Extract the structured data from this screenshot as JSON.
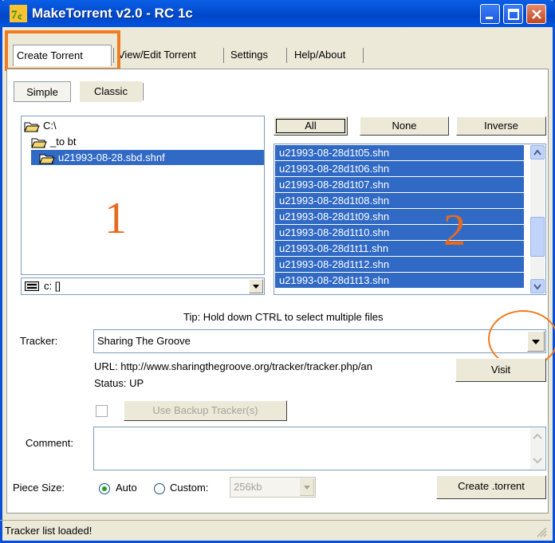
{
  "window": {
    "title": "MakeTorrent v2.0 - RC 1c"
  },
  "menu_tabs": [
    "Create Torrent",
    "View/Edit Torrent",
    "Settings",
    "Help/About"
  ],
  "mode_tabs": [
    "Simple",
    "Classic"
  ],
  "tree": {
    "items": [
      "C:\\",
      "_to bt",
      "u21993-08-28.sbd.shnf"
    ],
    "selected": "u21993-08-28.sbd.shnf"
  },
  "drive": {
    "value": "c: []"
  },
  "annotations": {
    "left_number": "1",
    "right_number": "2"
  },
  "select_buttons": {
    "all": "All",
    "none": "None",
    "inverse": "Inverse"
  },
  "files": [
    "u21993-08-28d1t05.shn",
    "u21993-08-28d1t06.shn",
    "u21993-08-28d1t07.shn",
    "u21993-08-28d1t08.shn",
    "u21993-08-28d1t09.shn",
    "u21993-08-28d1t10.shn",
    "u21993-08-28d1t11.shn",
    "u21993-08-28d1t12.shn",
    "u21993-08-28d1t13.shn"
  ],
  "tip": "Tip: Hold down CTRL to select multiple files",
  "tracker": {
    "label": "Tracker:",
    "value": "Sharing The Groove",
    "url": "URL: http://www.sharingthegroove.org/tracker/tracker.php/an",
    "status": "Status: UP",
    "visit": "Visit",
    "backup_label": "Use Backup Tracker(s)",
    "backup_checked": false
  },
  "comment": {
    "label": "Comment:",
    "value": ""
  },
  "piece_size": {
    "label": "Piece Size:",
    "auto_label": "Auto",
    "custom_label": "Custom:",
    "selected": "Auto",
    "custom_value": "256kb"
  },
  "create_button": "Create .torrent",
  "status_bar": "Tracker list loaded!",
  "colors": {
    "selection": "#316ac5",
    "annotation": "#f07c20",
    "titlebar": "#0a5fe6"
  }
}
